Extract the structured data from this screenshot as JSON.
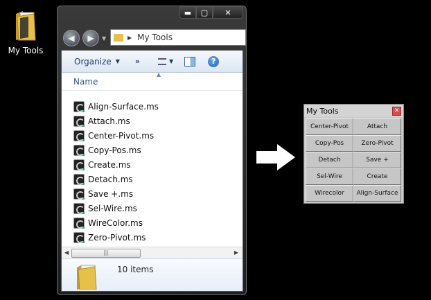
{
  "desktop": {
    "icon_label": "My Tools"
  },
  "explorer": {
    "caption": {
      "minimize": "▬",
      "maximize": "▢",
      "close": "✕"
    },
    "address": {
      "path": "My Tools"
    },
    "toolbar": {
      "organize_label": "Organize",
      "more_label": "»"
    },
    "column_header": "Name",
    "files": [
      "Align-Surface.ms",
      "Attach.ms",
      "Center-Pivot.ms",
      "Copy-Pos.ms",
      "Create.ms",
      "Detach.ms",
      "Save +.ms",
      "Sel-Wire.ms",
      "WireColor.ms",
      "Zero-Pivot.ms"
    ],
    "status": "10 items"
  },
  "panel": {
    "title": "My Tools",
    "buttons": [
      "Center-Pivot",
      "Attach",
      "Copy-Pos",
      "Zero-Pivot",
      "Detach",
      "Save +",
      "Sel-Wire",
      "Create",
      "Wirecolor",
      "Align-Surface"
    ]
  },
  "colors": {
    "background": "#000000",
    "folder": "#e6c14a",
    "panel_bg": "#c8c8c8",
    "close_red": "#d84d4d"
  }
}
